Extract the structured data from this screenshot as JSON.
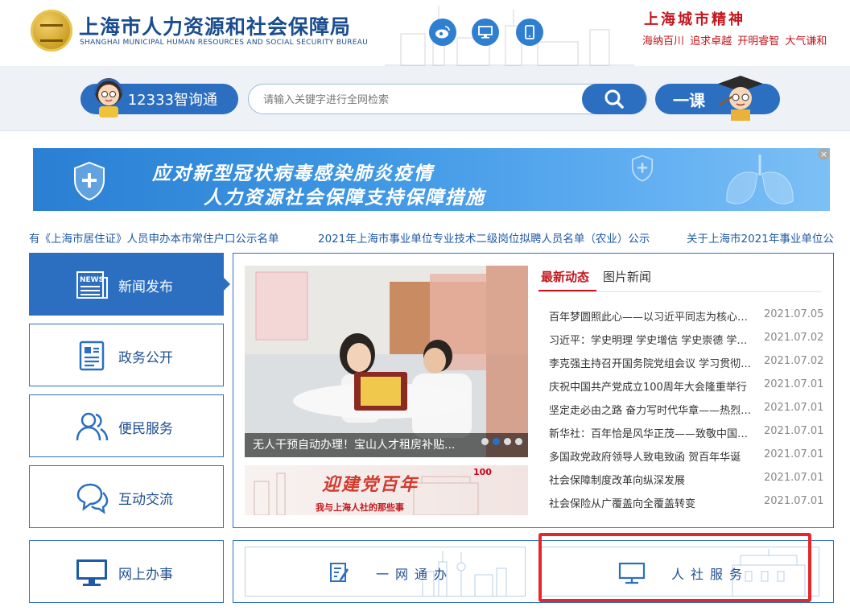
{
  "header": {
    "title_cn": "上海市人力资源和社会保障局",
    "title_en": "SHANGHAI MUNICIPAL HUMAN RESOURCES AND SOCIAL SECURITY BUREAU",
    "spirit_title": "上海城市精神",
    "spirit_words": "海纳百川  追求卓越  开明睿智  大气谦和",
    "icons": [
      "weibo-icon",
      "pc-icon",
      "mobile-icon"
    ]
  },
  "search": {
    "zhixun_label": "12333智询通",
    "placeholder": "请输入关键字进行全网检索",
    "yike_label": "一课"
  },
  "banner": {
    "line1": "应对新型冠状病毒感染肺炎疫情",
    "line2": "人力资源社会保障支持保障措施",
    "close": "×"
  },
  "ticker": {
    "items": [
      "有《上海市居住证》人员申办本市常住户口公示名单",
      "2021年上海市事业单位专业技术二级岗位拟聘人员名单（农业）公示",
      "关于上海市2021年事业单位公"
    ]
  },
  "nav": {
    "items": [
      {
        "label": "新闻发布"
      },
      {
        "label": "政务公开"
      },
      {
        "label": "便民服务"
      },
      {
        "label": "互动交流"
      },
      {
        "label": "网上办事"
      }
    ]
  },
  "featured": {
    "caption": "无人干预自动办理！宝山人才租房补贴...",
    "promo_title": "迎建党百年",
    "promo_sub": "我与上海人社的那些事",
    "promo_badge": "100"
  },
  "news": {
    "tabs": [
      "最新动态",
      "图片新闻"
    ],
    "items": [
      {
        "title": "百年梦圆照此心——以习近平同志为核心的党中央",
        "date": "2021.07.05"
      },
      {
        "title": "习近平：学史明理 学史增信 学史崇德 学史力行",
        "date": "2021.07.02"
      },
      {
        "title": "李克强主持召开国务院党组会议 学习贯彻习近平",
        "date": "2021.07.02"
      },
      {
        "title": "庆祝中国共产党成立100周年大会隆重举行",
        "date": "2021.07.01"
      },
      {
        "title": "坚定走必由之路 奋力写时代华章——热烈庆祝",
        "date": "2021.07.01"
      },
      {
        "title": "新华社：百年恰是风华正茂——致敬中国共产党",
        "date": "2021.07.01"
      },
      {
        "title": "多国政党政府领导人致电致函 贺百年华诞",
        "date": "2021.07.01"
      },
      {
        "title": "社会保障制度改革向纵深发展",
        "date": "2021.07.01"
      },
      {
        "title": "社会保险从广覆盖向全覆盖转变",
        "date": "2021.07.01"
      }
    ]
  },
  "services": {
    "ywtb": "一网通办",
    "rssfw": "人社服务"
  }
}
